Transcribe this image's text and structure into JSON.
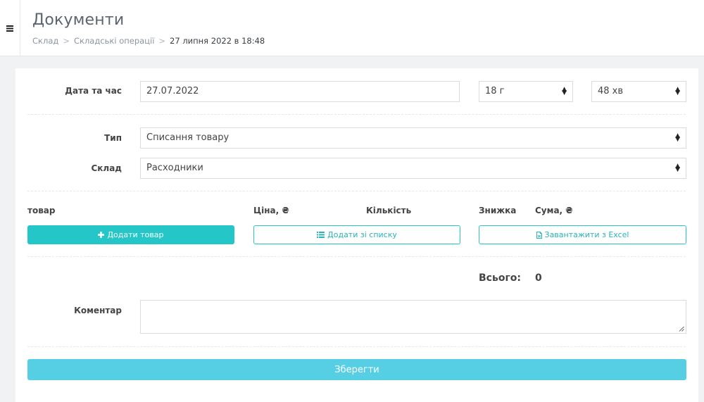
{
  "header": {
    "title": "Документи",
    "breadcrumb": {
      "items": [
        "Склад",
        "Складські операції"
      ],
      "current": "27 липня 2022 в 18:48",
      "separator": ">"
    }
  },
  "form": {
    "datetime": {
      "label": "Дата та час",
      "date_value": "27.07.2022",
      "hour_value": "18 г",
      "minute_value": "48 хв"
    },
    "type": {
      "label": "Тип",
      "value": "Списання товару"
    },
    "warehouse": {
      "label": "Склад",
      "value": "Расходники"
    },
    "items_table": {
      "columns": [
        "товар",
        "Ціна, ₴",
        "Кількість",
        "Знижка",
        "Сума, ₴"
      ]
    },
    "buttons": {
      "add_product": "Додати товар",
      "add_from_list": "Додати зі списку",
      "import_excel": "Завантажити з Excel",
      "save": "Зберегти"
    },
    "total": {
      "label": "Всього:",
      "value": "0"
    },
    "comment": {
      "label": "Коментар",
      "value": ""
    }
  },
  "colors": {
    "accent": "#25c6c7",
    "save_button": "#56cfe4"
  },
  "icons": [
    "menu-icon",
    "plus-icon",
    "list-icon",
    "file-icon",
    "select-arrows-icon",
    "resize-grip-icon"
  ]
}
